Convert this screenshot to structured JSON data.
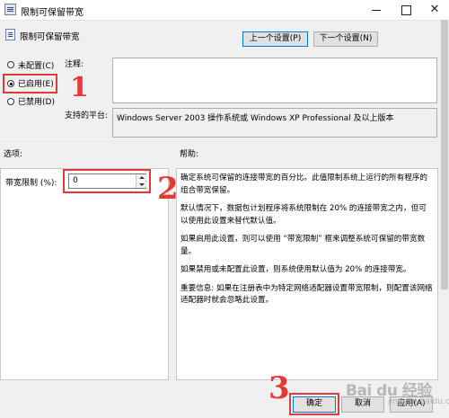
{
  "window": {
    "title": "限制可保留带宽",
    "close_glyph": "✕"
  },
  "header": {
    "setting_name": "限制可保留带宽",
    "prev_label": "上一个设置(P)",
    "next_label": "下一个设置(N)"
  },
  "state": {
    "options": [
      {
        "label": "未配置(C)",
        "selected": false
      },
      {
        "label": "已启用(E)",
        "selected": true
      },
      {
        "label": "已禁用(D)",
        "selected": false
      }
    ]
  },
  "comment": {
    "label": "注释:",
    "value": ""
  },
  "platform": {
    "label": "支持的平台:",
    "value": "Windows Server 2003 操作系统或 Windows XP Professional 及以上版本"
  },
  "options_section": {
    "title": "选项:",
    "bandwidth_label": "带宽限制 (%):",
    "bandwidth_value": "0"
  },
  "help_section": {
    "title": "帮助:",
    "paragraphs": [
      "确定系统可保留的连接带宽的百分比。此值限制系统上运行的所有程序的组合带宽保留。",
      "默认情况下，数据包计划程序将系统限制在 20% 的连接带宽之内，但可以使用此设置来替代默认值。",
      "如果启用此设置，则可以使用 “带宽限制” 框来调整系统可保留的带宽数量。",
      "如果禁用或未配置此设置，则系统使用默认值为 20% 的连接带宽。",
      "重要信息: 如果在注册表中为特定网络适配器设置带宽限制，则配置该网络适配器时就会忽略此设置。"
    ]
  },
  "footer": {
    "ok_label": "确定",
    "cancel_label": "取消",
    "apply_label": "应用(A)"
  },
  "annotations": {
    "step1": "1",
    "step2": "2",
    "step3": "3",
    "color": "#e53935"
  },
  "watermark": {
    "brand": "Bai du 经验",
    "sub": "jingyan.baidu.com"
  }
}
